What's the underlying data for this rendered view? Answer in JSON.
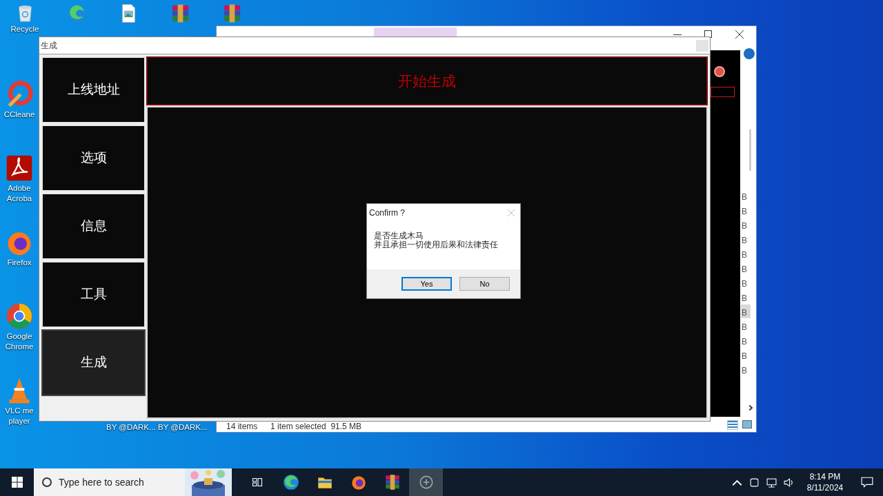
{
  "desktop_icons": [
    {
      "kind": "recycle",
      "lines": [
        "Recycle"
      ]
    },
    {
      "kind": "edge"
    },
    {
      "kind": "image-file"
    },
    {
      "kind": "archive"
    },
    {
      "kind": "archive"
    },
    {
      "kind": "ccleaner",
      "lines": [
        "CCleane"
      ]
    },
    {
      "kind": "acrobat",
      "lines": [
        "Adobe",
        "Acroba"
      ]
    },
    {
      "kind": "firefox",
      "lines": [
        "Firefox"
      ]
    },
    {
      "kind": "chrome",
      "lines": [
        "Google",
        "Chrome"
      ]
    },
    {
      "kind": "vlc",
      "lines": [
        "VLC me",
        "player"
      ]
    }
  ],
  "desktop_labels": [
    "BY @DARK...",
    "BY @DARK..."
  ],
  "explorer": {
    "size_fragments": [
      {
        "text": "B",
        "selected": false
      },
      {
        "text": "B",
        "selected": false
      },
      {
        "text": "B",
        "selected": false
      },
      {
        "text": "B",
        "selected": false
      },
      {
        "text": "B",
        "selected": false
      },
      {
        "text": "B",
        "selected": false
      },
      {
        "text": "B",
        "selected": false
      },
      {
        "text": "B",
        "selected": false
      },
      {
        "text": "B",
        "selected": true
      },
      {
        "text": "B",
        "selected": false
      },
      {
        "text": "B",
        "selected": false
      },
      {
        "text": "B",
        "selected": false
      },
      {
        "text": "B",
        "selected": false
      }
    ],
    "status_items": "14 items",
    "status_selection": "1 item selected  91.5 MB"
  },
  "builder": {
    "title": "生成",
    "nav": [
      {
        "label": "上线地址",
        "selected": false
      },
      {
        "label": "选项",
        "selected": false
      },
      {
        "label": "信息",
        "selected": false
      },
      {
        "label": "工具",
        "selected": false
      },
      {
        "label": "生成",
        "selected": true
      }
    ],
    "header": "开始生成"
  },
  "dialog": {
    "title": "Confirm ?",
    "lines": [
      "是否生成木马",
      "并且承担一切使用后果和法律责任"
    ],
    "buttons": [
      {
        "label": "Yes",
        "default": true
      },
      {
        "label": "No",
        "default": false
      }
    ]
  },
  "taskbar": {
    "search_placeholder": "Type here to search",
    "apps": [
      {
        "kind": "task-view",
        "active": false
      },
      {
        "kind": "edge",
        "active": false
      },
      {
        "kind": "folder",
        "active": false
      },
      {
        "kind": "firefox",
        "active": false
      },
      {
        "kind": "archive",
        "active": false
      },
      {
        "kind": "app",
        "active": true
      }
    ],
    "time": "8:14 PM",
    "date": "8/11/2024"
  }
}
